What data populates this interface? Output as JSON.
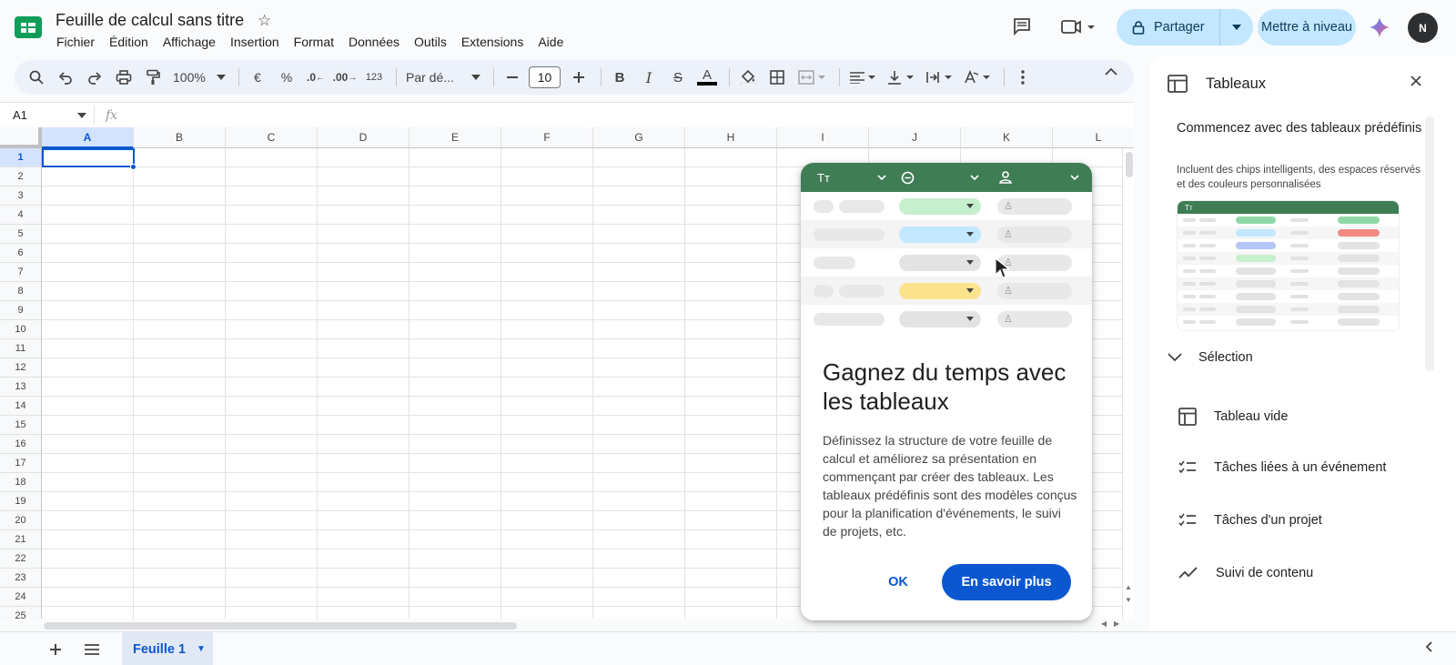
{
  "header": {
    "title": "Feuille de calcul sans titre",
    "menus": [
      "Fichier",
      "Édition",
      "Affichage",
      "Insertion",
      "Format",
      "Données",
      "Outils",
      "Extensions",
      "Aide"
    ],
    "share_label": "Partager",
    "upgrade_label": "Mettre à niveau",
    "avatar_initials": "N"
  },
  "toolbar": {
    "zoom": "100%",
    "currency": "€",
    "percent": "%",
    "dec_less": ".0",
    "dec_more": ".00",
    "number_format": "123",
    "font": "Par dé...",
    "font_size": "10"
  },
  "formula_bar": {
    "cell_ref": "A1",
    "fx": "fx"
  },
  "grid": {
    "columns": [
      "A",
      "B",
      "C",
      "D",
      "E",
      "F",
      "G",
      "H",
      "I",
      "J",
      "K",
      "L"
    ],
    "rows": [
      "1",
      "2",
      "3",
      "4",
      "5",
      "6",
      "7",
      "8",
      "9",
      "10",
      "11",
      "12",
      "13",
      "14",
      "15",
      "16",
      "17",
      "18",
      "19",
      "20",
      "21",
      "22",
      "23",
      "24",
      "25"
    ],
    "active_column": "A",
    "active_row": "1"
  },
  "popup": {
    "title": "Gagnez du temps avec les tableaux",
    "body": "Définissez la structure de votre feuille de calcul et améliorez sa présentation en commençant par créer des tableaux. Les tableaux prédéfinis sont des modèles conçus pour la planification d'événements, le suivi de projets, etc.",
    "ok_label": "OK",
    "more_label": "En savoir plus",
    "header_color": "#3f7d55",
    "chip_colors": [
      "#c6efce",
      "#c2e7ff",
      "#e3e3e3",
      "#fbe38e",
      "#e3e3e3"
    ]
  },
  "side_panel": {
    "title": "Tableaux",
    "heading": "Commencez avec des tableaux prédéfinis",
    "subheading": "Incluent des chips intelligents, des espaces réservés et des couleurs personnalisées",
    "section_label": "Sélection",
    "items": [
      {
        "label": "Tableau vide",
        "icon": "table-icon"
      },
      {
        "label": "Tâches liées à un événement",
        "icon": "checklist-icon"
      },
      {
        "label": "Tâches d'un projet",
        "icon": "checklist-icon"
      },
      {
        "label": "Suivi de contenu",
        "icon": "trend-icon"
      }
    ]
  },
  "bottom": {
    "sheet_name": "Feuille 1"
  },
  "colors": {
    "accent": "#0b57d0",
    "share_bg": "#c2e7ff",
    "sheets_green": "#0f9d58"
  }
}
